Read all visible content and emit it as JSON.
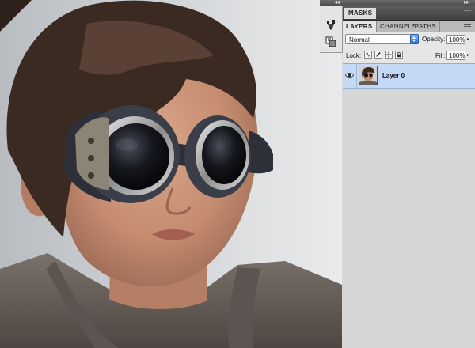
{
  "panels": {
    "masks": {
      "tab_label": "MASKS"
    },
    "layers": {
      "tabs": [
        {
          "label": "LAYERS",
          "active": true
        },
        {
          "label": "CHANNELS",
          "active": false
        },
        {
          "label": "PATHS",
          "active": false
        }
      ],
      "blend_mode": {
        "value": "Normal"
      },
      "opacity": {
        "label": "Opacity:",
        "value": "100%"
      },
      "lock": {
        "label": "Lock:",
        "icons": [
          "lock-transparent-icon",
          "lock-image-pixels-icon",
          "lock-position-icon",
          "lock-all-icon"
        ]
      },
      "fill": {
        "label": "Fill:",
        "value": "100%"
      },
      "layer_list": [
        {
          "name": "Layer 0",
          "visible": true,
          "selected": true
        }
      ]
    },
    "dock_icons": [
      "brush-presets-icon",
      "clone-source-icon"
    ]
  },
  "colors": {
    "selected_row": "#c3d9f5",
    "accent_blue": "#2a6fd8",
    "panel_bg": "#d6d6d6"
  }
}
